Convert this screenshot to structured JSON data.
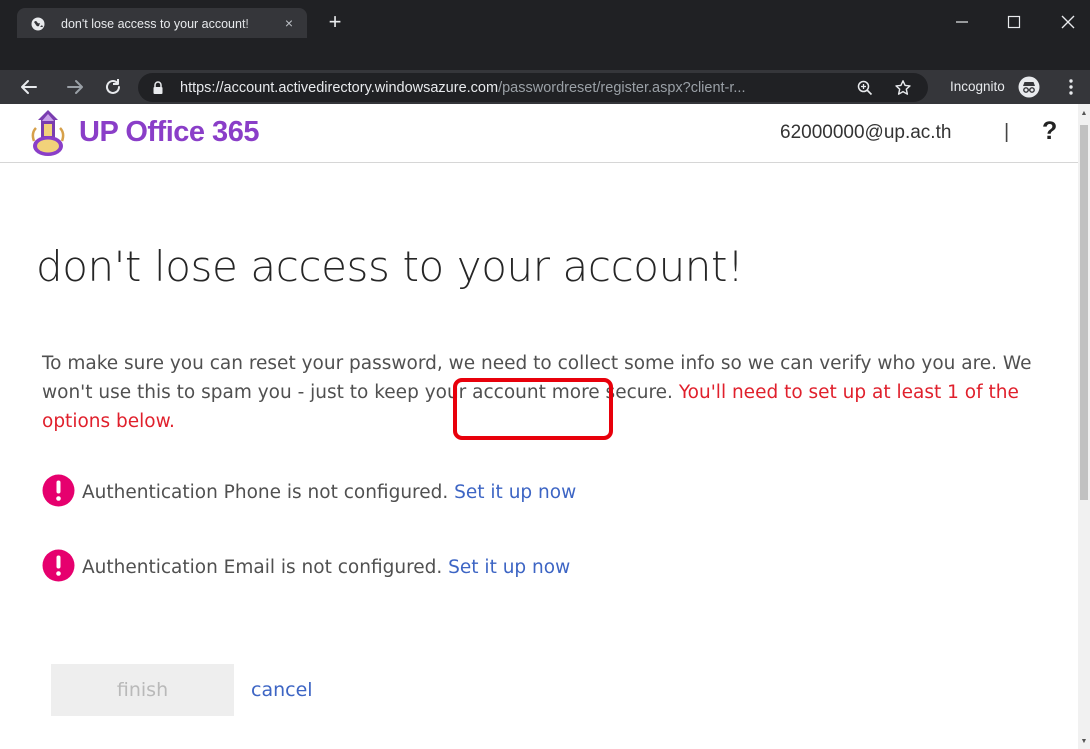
{
  "browser": {
    "tab_title": "don't lose access to your account!",
    "tab_close": "×",
    "new_tab": "+",
    "url_host": "https://account.activedirectory.windowsazure.com",
    "url_path": "/passwordreset/register.aspx?client-r...",
    "incognito_label": "Incognito",
    "window_controls": {
      "minimize": "—",
      "maximize": "☐",
      "close": "✕"
    }
  },
  "header": {
    "brand": "UP Office 365",
    "user_email": "62000000@up.ac.th",
    "separator": "|",
    "help": "?"
  },
  "main": {
    "title": "don't lose access to your account!",
    "intro": "To make sure you can reset your password, we need to collect some info so we can verify who you are. We won't use this to spam you - just to keep your account more secure.",
    "intro_warning": "You'll need to set up at least 1 of the options below.",
    "items": [
      {
        "status": "Authentication Phone is not configured.",
        "link": "Set it up now"
      },
      {
        "status": "Authentication Email is not configured.",
        "link": "Set it up now"
      }
    ],
    "finish_label": "finish",
    "cancel_label": "cancel"
  },
  "colors": {
    "brand": "#8a3ec8",
    "link": "#3d65c4",
    "warning": "#e0202c",
    "error_icon": "#e6006e",
    "highlight": "#e8000b"
  }
}
